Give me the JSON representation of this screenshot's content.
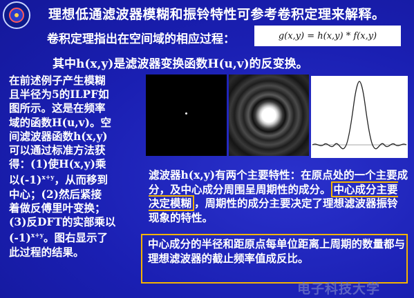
{
  "slide": {
    "title": "理想低通滤波器模糊和振铃特性可参考卷积定理来解释。",
    "line2": "卷积定理指出在空间域的相应过程：",
    "formula": "g(x,y) = h(x,y) * f(x,y)",
    "line3": "其中h(x,y)是滤波器变换函数H(u,v)的反变换。",
    "left_text": [
      "在前述例子产生模糊",
      "且半径为5的ILPF如",
      "图所示。这是在频率",
      "域的函数H(u,v)。空",
      "间滤波器函数h(x,y)",
      "可以通过标准方法获",
      "得：(1)使H(x,y)乘",
      "以(-1)",
      "x+y",
      "，从而移到",
      "中心；(2)然后紧接",
      "着做反傅里叶变换；",
      "(3)反DFT的实部乘以",
      "(-1)",
      "x+y",
      "。图右显示了",
      "此过程的结果。"
    ],
    "para2_a": "滤波器h(x,y)有两个主要特性：在原点处的一个主要成分，及中心成分周围呈周期性的成分。",
    "para2_highlight": "中心成分主要决定模糊",
    "para2_b": "，周期性的成分主要决定了理想滤波器振铃现象的特性。",
    "para3": "中心成分的半径和距原点每单位距离上周期的数量都与理想滤波器的截止频率值成反比。",
    "watermark": "电子科技大学"
  },
  "colors": {
    "background": "#1b21b8",
    "text": "#ffffff",
    "highlight_border": "#f5b400"
  },
  "icons": {
    "logo": "university-logo-icon"
  }
}
